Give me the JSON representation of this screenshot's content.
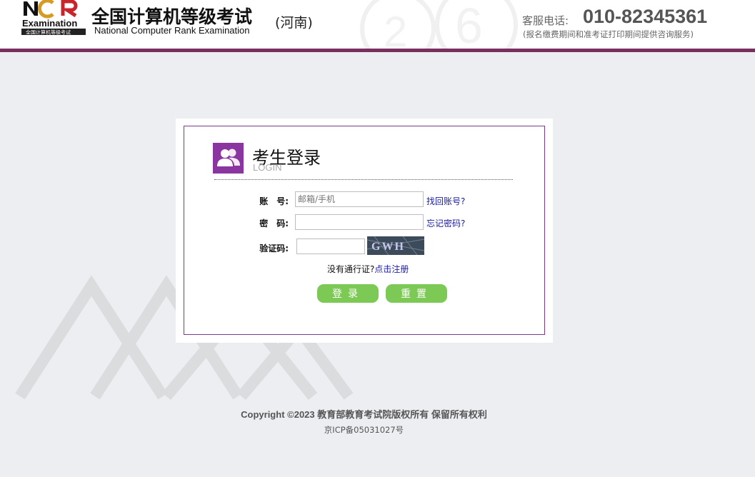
{
  "header": {
    "logo_text": "Examination",
    "logo_caption": "全国计算机等级考试",
    "title_cn": "全国计算机等级考试",
    "title_en": "National Computer Rank Examination",
    "province": "(河南)",
    "phone_label": "客服电话:",
    "phone_number": "010-82345361",
    "phone_note": "(报名缴费期间和准考证打印期间提供咨询服务)"
  },
  "login": {
    "title": "考生登录",
    "subtitle": "LOGIN",
    "account_label": "账　号:",
    "account_placeholder": "邮箱/手机",
    "account_link": "找回账号?",
    "password_label": "密　码:",
    "password_link": "忘记密码?",
    "captcha_label": "验证码:",
    "captcha_text": "GWH",
    "register_prompt": "没有通行证?",
    "register_link": "点击注册",
    "login_button": "登录",
    "reset_button": "重置"
  },
  "footer": {
    "copyright": "Copyright ©2023 教育部教育考试院版权所有 保留所有权利",
    "icp": "京ICP备05031027号"
  },
  "colors": {
    "brand_bar": "#7a2f5e",
    "login_border": "#7b3a8a",
    "icon_bg": "#8a35a0",
    "button_green": "#7dc955",
    "link_blue": "#1a1aa6"
  },
  "icons": {
    "login_icon": "users-icon",
    "logo": "ncre-logo"
  }
}
